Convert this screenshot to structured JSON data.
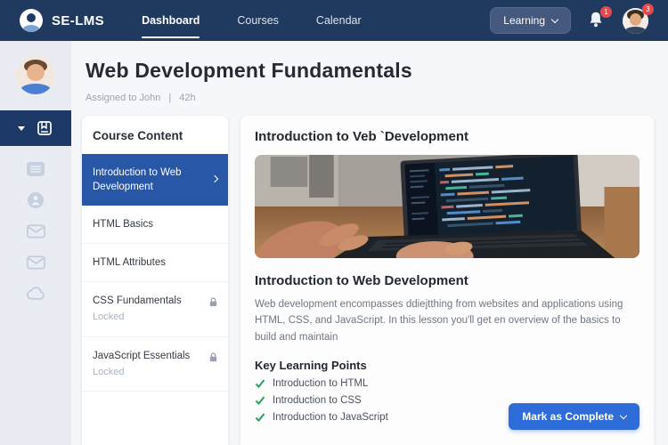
{
  "topbar": {
    "brand": "SE-LMS",
    "nav": [
      {
        "label": "Dashboard",
        "active": true
      },
      {
        "label": "Courses",
        "active": false
      },
      {
        "label": "Calendar",
        "active": false
      }
    ],
    "learning_label": "Learning",
    "bell_badge": "1",
    "avatar_badge": "3"
  },
  "page": {
    "title": "Web Development Fundamentals",
    "assigned": "Assigned to John",
    "divider": "|",
    "duration": "42h"
  },
  "course": {
    "header": "Course Content",
    "items": [
      {
        "label": "Introduction to Web Development",
        "state": "selected"
      },
      {
        "label": "HTML Basics",
        "state": "normal"
      },
      {
        "label": "HTML Attributes",
        "state": "normal"
      },
      {
        "label": "CSS Fundamentals",
        "sub": "Locked",
        "state": "locked"
      },
      {
        "label": "JavaScript Essentials",
        "sub": "Locked",
        "state": "locked"
      }
    ]
  },
  "lesson": {
    "title": "Introduction to Veb `Development",
    "heading": "Introduction to Web Development",
    "body": "Web development encompasses ddiejtthing from websites and applications using HTML, CSS, and JavaScript. In this lesson you'll get en overview of the basics to build and maintain",
    "key_points_title": "Key Learning Points",
    "key_points": [
      "Introduction to HTML",
      "Introduction to CSS",
      "Introduction to JavaScript"
    ],
    "complete_button": "Mark as Complete"
  },
  "colors": {
    "navbar": "#20395f",
    "active_item_blue": "#2857a8",
    "button_blue": "#2e6cd9",
    "badge_red": "#e5484d",
    "check_green": "#27a05f"
  }
}
